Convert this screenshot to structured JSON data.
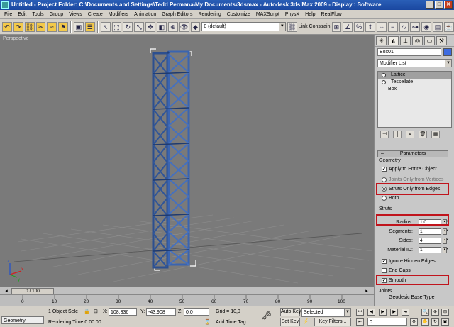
{
  "window": {
    "title": "Untitled     - Project Folder: C:\\Documents and Settings\\Tedd Permana\\My Documents\\3dsmax     - Autodesk 3ds Max  2009          - Display : Software",
    "buttons": [
      "_",
      "□",
      "✕"
    ]
  },
  "menu": [
    "File",
    "Edit",
    "Tools",
    "Group",
    "Views",
    "Create",
    "Modifiers",
    "Animation",
    "Graph Editors",
    "Rendering",
    "Customize",
    "MAXScript",
    "PhysX",
    "Help",
    "RealFlow"
  ],
  "toolbar": {
    "layer": "0 (default)",
    "link_constraint": "Link Constrain"
  },
  "viewport": {
    "label": "Perspective",
    "axis_x": "x",
    "axis_y": "y",
    "axis_z": "z"
  },
  "panel": {
    "object_name": "Box01",
    "object_color": "#3d6be0",
    "modifier_list": "Modifier List",
    "stack": [
      "Lattice",
      "Tessellate",
      "Box"
    ],
    "rollout_title": "Parameters",
    "geometry_label": "Geometry",
    "apply_entire": "Apply to Entire Object",
    "joints_only": "Joints Only from Vertices",
    "struts_only": "Struts Only from Edges",
    "both": "Both",
    "struts_label": "Struts",
    "radius_label": "Radius:",
    "radius_value": "1,0",
    "segments_label": "Segments:",
    "segments_value": "1",
    "sides_label": "Sides:",
    "sides_value": "4",
    "material_label": "Material ID:",
    "material_value": "1",
    "ignore_hidden": "Ignore Hidden Edges",
    "end_caps": "End Caps",
    "smooth": "Smooth",
    "joints_label": "Joints",
    "geodesic": "Geodesic Base Type"
  },
  "timeline": {
    "slider": "0 / 100",
    "ticks": [
      "0",
      "10",
      "20",
      "30",
      "40",
      "50",
      "60",
      "70",
      "80",
      "90",
      "100"
    ]
  },
  "status": {
    "geometry_tab": "Geometry",
    "selection": "1 Object Sele",
    "x_label": "X:",
    "x_value": "108,336",
    "y_label": "Y:",
    "y_value": "-43,908",
    "z_label": "Z:",
    "z_value": "0,0",
    "grid": "Grid = 10,0",
    "auto_key": "Auto Key",
    "selected": "Selected",
    "set_key": "Set Key",
    "key_filters": "Key Filters...",
    "rendering_time": "Rendering Time  0:00:00",
    "add_time_tag": "Add Time Tag",
    "frame": "0"
  }
}
